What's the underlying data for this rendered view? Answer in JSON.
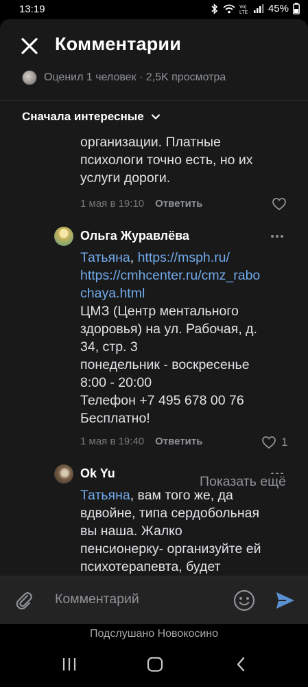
{
  "status_bar": {
    "time": "13:19",
    "battery": "45%"
  },
  "header": {
    "title": "Комментарии",
    "meta": "Оценил 1 человек · 2,5K просмотра"
  },
  "sort": {
    "label": "Сначала интересные"
  },
  "comments": [
    {
      "text_fragment": "организации. Платные\nпсихологи точно есть, но их\nуслуги дороги.",
      "date": "1 мая в 19:10",
      "reply_label": "Ответить",
      "likes": ""
    },
    {
      "author": "Ольга Журавлёва",
      "mention": "Татьяна",
      "links_line1": "https://msph.ru/",
      "links_line2": "https://cmhcenter.ru/cmz_rabo\nchaya.html",
      "text": "ЦМЗ (Центр ментального\nздоровья) на ул. Рабочая, д.\n34, стр. 3\nпонедельник - воскресенье\n8:00 - 20:00\nТелефон +7 495 678 00 76\nБесплатно!",
      "date": "1 мая в 19:40",
      "reply_label": "Ответить",
      "likes": "1"
    },
    {
      "author": "Ok Yu",
      "mention": "Татьяна",
      "text": ", вам того же, да\nвдвойне, типа сердобольная\nвы наша. Жалко\nпенсионерку- организуйте ей\nпсихотерапевта, будет\nпомощь, чтоб что"
    }
  ],
  "show_more": "Показать ещё",
  "composer": {
    "placeholder": "Комментарий"
  },
  "footer": {
    "community": "Подслушано Новокосино"
  },
  "colors": {
    "link": "#71aaeb",
    "send": "#5a8fd0",
    "background": "#19191a"
  }
}
